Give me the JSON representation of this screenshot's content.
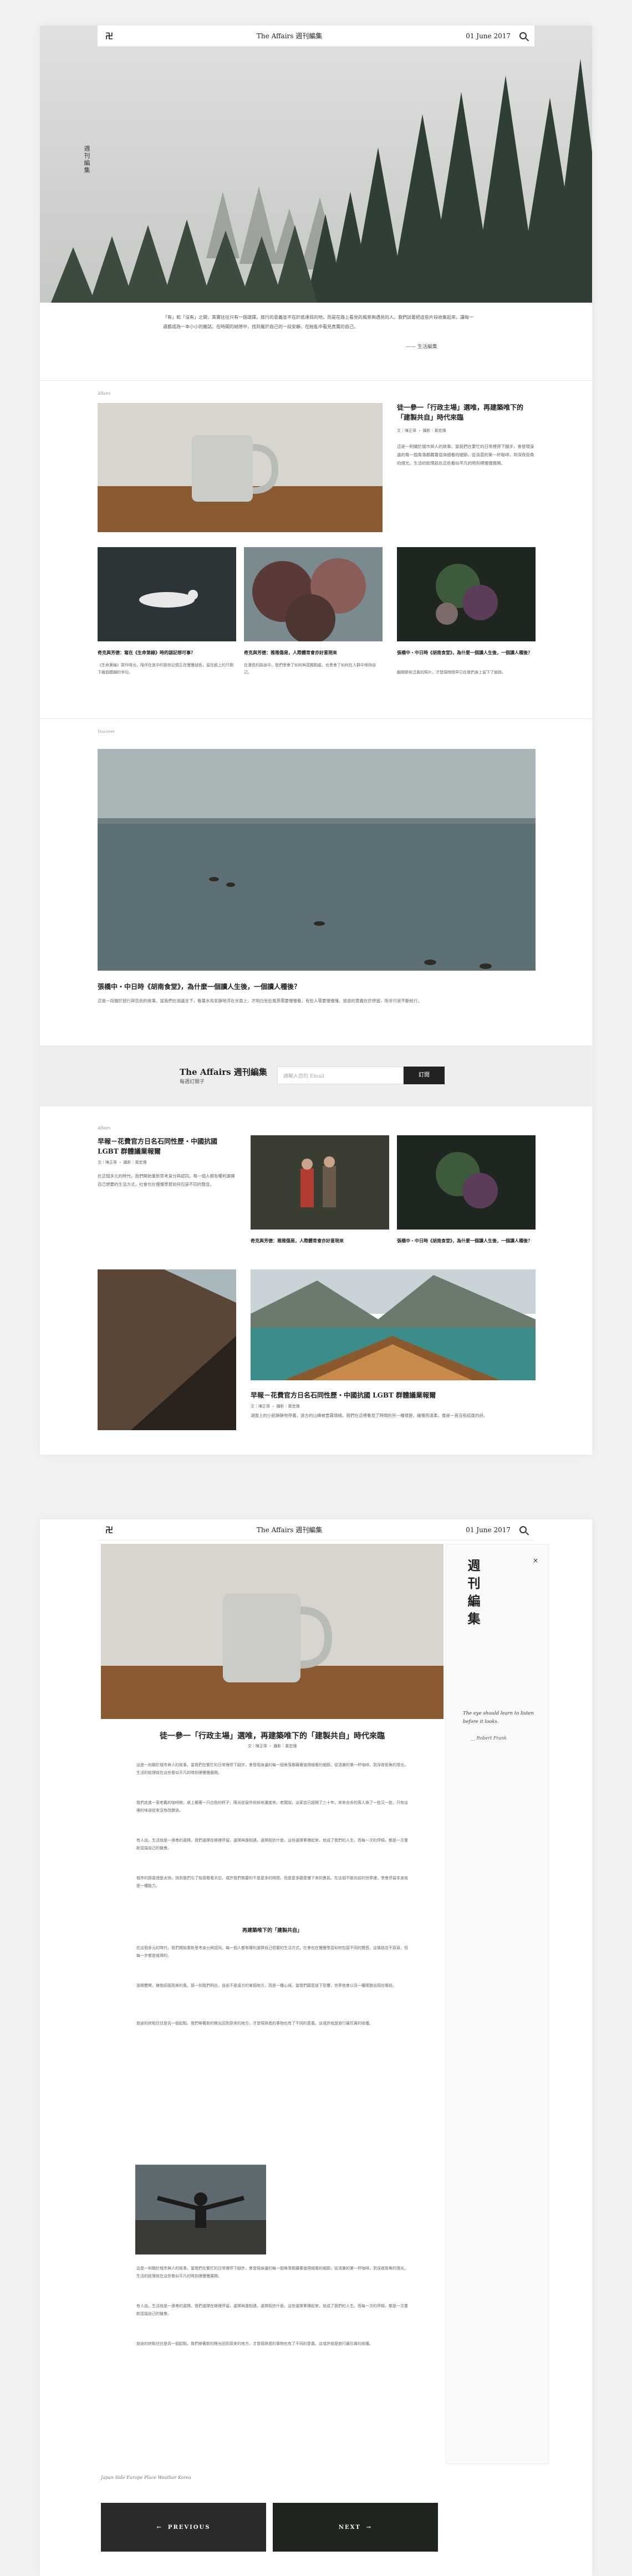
{
  "site": {
    "brand": "The Affairs 週刊編集",
    "date": "01 June 2017",
    "logo": "卍",
    "icons": {
      "search": "search-icon"
    }
  },
  "hero": {
    "vertical_label": "週刊編集",
    "intro": "「有」和「沒有」之間，其實往往只有一個選擇。旅行的意義並不在於抵達目的地，而是在路上看見的風景與遇見的人。我們試著把這些片段收集起來，讓每一週都成為一本小小的雜誌。在時間的縫隙中，找到屬於自己的一段安靜，在紛亂中看見真實的自己。",
    "signature": "—— 生活編集"
  },
  "section1": {
    "label": "Affairs",
    "feature": {
      "title": "徒一參一「行政主場」選唯，再建築唯下的「建製共自」時代來臨",
      "meta": "文｜陳正偉 ・ 攝影｜黃宏傳",
      "body": "這是一則關於城市與人的故事。當我們在繁忙的日常裡停下腳步，會發現身邊的每一個角落都藏著值得細看的細節。從清晨的第一杯咖啡，到深夜街角的燈光，生活的紋理就在這些看似平凡的時刻裡慢慢展開。"
    },
    "cards": [
      {
        "title": "奇克與芳德：寫在《生命第線》時的誤記想可事？",
        "body": "《生命第線》寫作時光，陪伴在其中的那些記憶正在慢慢褪色，留在紙上的只剩下幾個模糊的字句。"
      },
      {
        "title": "奇克與芳德：雅雅傷是，人際體育會亦好意現來",
        "body": "在漫長的路途中，我們學會了如何與孤獨相處，也學會了如何在人群中保持自己。"
      },
      {
        "title": "張橋中・中日時《胡南食堂》，為什麼一個讀人生後，一個讀人種後？",
        "body": "翻開那些泛黃的照片，才發現時間早已在我們身上留下了痕跡。"
      }
    ]
  },
  "section2": {
    "label": "Discover",
    "title": "張橋中・中日時《胡南食堂》，為什麼一個讀人生後，一個讀人種後？",
    "body": "這是一段關於旅行與告別的故事。當我們在湖邊坐下，看著水鳥安靜地浮在水面上，才明白有些風景需要慢慢看，有些人需要慢慢懂。旅途的意義在於停留，而非只是不斷前行。"
  },
  "newsletter": {
    "title": "The Affairs 週刊編集",
    "subtitle": "每週訂閱子",
    "placeholder": "請輸入您的 Email",
    "button": "訂閱"
  },
  "section3": {
    "label": "Affairs",
    "feature": {
      "title": "早報－花費官方日名石同性歷・中國抗國 LGBT 群體議業報爾",
      "meta": "文｜陳正偉 ・ 攝影｜黃宏傳",
      "body": "在這個多元的時代，我們開始重新思考身分與認同。每一個人都有權利選擇自己想要的生活方式，社會也在慢慢學習如何包容不同的聲音。"
    },
    "cards": [
      {
        "title": "奇克與芳德：雅雅傷是，人際體育會亦好意現來"
      },
      {
        "title": "張橋中・中日時《胡南食堂》，為什麼一個讀人生後，一個讀人種後？"
      }
    ],
    "bottom": {
      "title": "早報－花費官方日名石同性歷・中國抗國 LGBT 群體議業報爾",
      "meta": "文｜陳正偉 ・ 攝影｜黃宏傳",
      "body": "湖面上的小船靜靜地停著，遠方的山峰被雲霧環繞。我們在這裡看見了時間的另一種樣貌，緩慢而溫柔，像是一首沒有結尾的詩。"
    }
  },
  "article": {
    "title": "徒一參一「行政主場」選唯，再建築唯下的「建製共自」時代來臨",
    "meta": "文｜陳正偉 ・ 攝影｜黃宏傳",
    "paragraphs": [
      "這是一則關於城市與人的故事。當我們在繁忙的日常裡停下腳步，會發現身邊的每一個角落都藏著值得細看的細節。從清晨的第一杯咖啡，到深夜街角的燈光，生活的紋理就在這些看似平凡的時刻裡慢慢展開。",
      "我們走進一家老舊的咖啡館，桌上擺著一只白色的杯子，陽光從窗外斜斜地灑進來。老闆說，這家店已經開了三十年，來來去去的客人換了一批又一批，只有這裡的味道從來沒有改變過。",
      "有人說，生活就是一連串的選擇。我們選擇在哪裡停留，選擇與誰相遇，選擇相信什麼。這些選擇累積起來，就成了我們的人生。而每一次的停頓，都是一次重新認識自己的機會。",
      "城市的節奏總是太快，快到我們忘了抬頭看看天空。或許我們需要的不是更多的時間，而是更多願意慢下來的勇氣。在這個不斷向前的世界裡，學會停留本身就是一種能力。"
    ],
    "subhead": "再建築唯下的「建製共自」",
    "paragraphs2": [
      "在這個多元的時代，我們開始重新思考身分與認同。每一個人都有權利選擇自己想要的生活方式，社會也在慢慢學習如何包容不同的聲音。這條路並不容易，但每一步都是值得的。",
      "張開雙臂，擁抱迎面而來的風。那一刻我們明白，自由不是遠方的某個地方，而是一種心境。當我們願意放下恐懼，世界就會以另一種樣貌出現在眼前。",
      "旅途的終點往往是另一個起點。我們帶著新的眼光回到原來的地方，才發現熟悉的事物也有了不同的意義。這或許就是旅行最珍貴的收穫。"
    ],
    "tags": "Japan  Side Europe  Place  Weather  Korea"
  },
  "aside": {
    "title": "週刊編集",
    "close": "×",
    "quote": "The eye should learn to listen before it looks.",
    "cite": "__ Robert Frank"
  },
  "pager": {
    "previous": "PREVIOUS",
    "next": "NEXT"
  }
}
